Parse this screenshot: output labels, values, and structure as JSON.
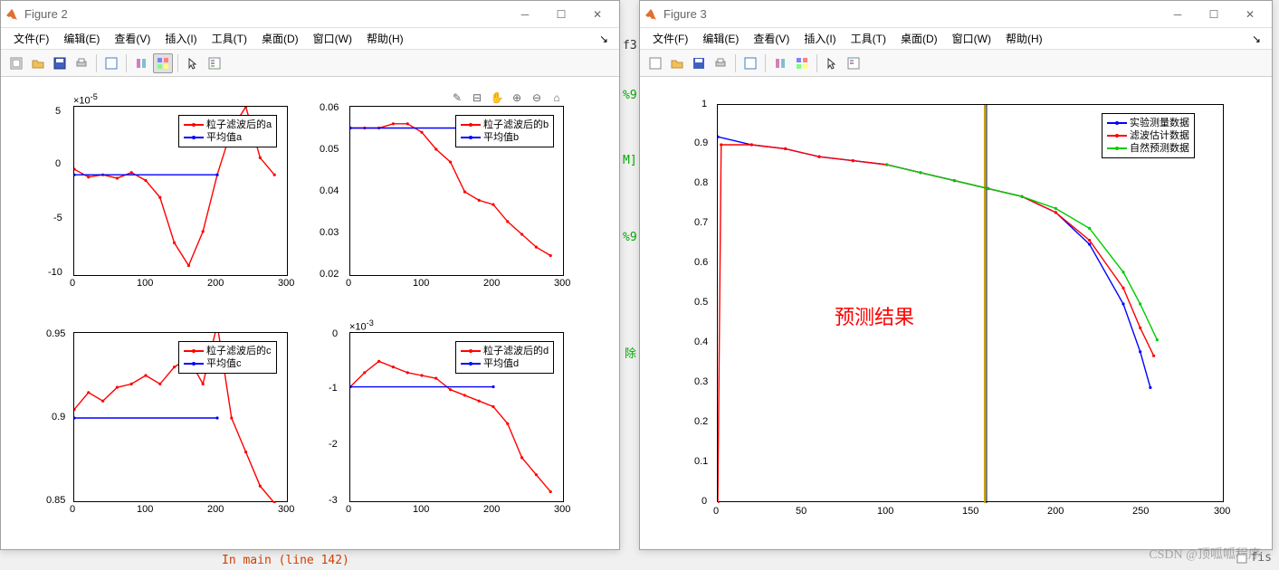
{
  "windows": [
    {
      "title": "Figure 2"
    },
    {
      "title": "Figure 3"
    }
  ],
  "menus": [
    "文件(F)",
    "编辑(E)",
    "查看(V)",
    "插入(I)",
    "工具(T)",
    "桌面(D)",
    "窗口(W)",
    "帮助(H)"
  ],
  "figure2": {
    "sub_a": {
      "exponent": "×10",
      "exponent_sup": "-5",
      "yticks": [
        "5",
        "0",
        "-5",
        "-10"
      ],
      "xticks": [
        "0",
        "100",
        "200",
        "300"
      ],
      "legend": [
        "粒子滤波后的a",
        "平均值a"
      ]
    },
    "sub_b": {
      "yticks": [
        "0.06",
        "0.05",
        "0.04",
        "0.03",
        "0.02"
      ],
      "xticks": [
        "0",
        "100",
        "200",
        "300"
      ],
      "legend": [
        "粒子滤波后的b",
        "平均值b"
      ]
    },
    "sub_c": {
      "yticks": [
        "0.95",
        "0.9",
        "0.85"
      ],
      "xticks": [
        "0",
        "100",
        "200",
        "300"
      ],
      "legend": [
        "粒子滤波后的c",
        "平均值c"
      ]
    },
    "sub_d": {
      "exponent": "×10",
      "exponent_sup": "-3",
      "yticks": [
        "0",
        "-1",
        "-2",
        "-3"
      ],
      "xticks": [
        "0",
        "100",
        "200",
        "300"
      ],
      "legend": [
        "粒子滤波后的d",
        "平均值d"
      ]
    }
  },
  "figure3": {
    "yticks": [
      "1",
      "0.9",
      "0.8",
      "0.7",
      "0.6",
      "0.5",
      "0.4",
      "0.3",
      "0.2",
      "0.1",
      "0"
    ],
    "xticks": [
      "0",
      "50",
      "100",
      "150",
      "200",
      "250",
      "300"
    ],
    "legend": [
      "实验测量数据",
      "滤波估计数据",
      "自然预测数据"
    ],
    "annotation": "预测结果"
  },
  "bg": {
    "f3": "f3",
    "m": "M]",
    "pct1": "%9",
    "pct2": "%9",
    "chu": "除",
    "main_line": "In main (line 142)",
    "fis": "fis"
  },
  "watermark": "CSDN @顶呱呱程序",
  "chart_data": [
    {
      "type": "line",
      "title": "",
      "xlabel": "",
      "ylabel": "",
      "exponent": 1e-05,
      "xlim": [
        0,
        300
      ],
      "ylim": [
        -10,
        5
      ],
      "series": [
        {
          "name": "粒子滤波后的a",
          "color": "#ff0000",
          "x": [
            0,
            20,
            40,
            60,
            80,
            100,
            120,
            140,
            160,
            180,
            200,
            220,
            240,
            260,
            280
          ],
          "y": [
            -0.5,
            -1.2,
            -1.0,
            -1.3,
            -0.8,
            -1.5,
            -3.0,
            -7.0,
            -9.0,
            -6.0,
            -1.0,
            3.0,
            5.0,
            0.5,
            -1.0
          ]
        },
        {
          "name": "平均值a",
          "color": "#0000ff",
          "x": [
            0,
            200
          ],
          "y": [
            -1.0,
            -1.0
          ]
        }
      ]
    },
    {
      "type": "line",
      "title": "",
      "xlabel": "",
      "ylabel": "",
      "xlim": [
        0,
        300
      ],
      "ylim": [
        0.02,
        0.06
      ],
      "series": [
        {
          "name": "粒子滤波后的b",
          "color": "#ff0000",
          "x": [
            0,
            20,
            40,
            60,
            80,
            100,
            120,
            140,
            160,
            180,
            200,
            220,
            240,
            260,
            280
          ],
          "y": [
            0.055,
            0.055,
            0.055,
            0.056,
            0.056,
            0.054,
            0.05,
            0.047,
            0.04,
            0.038,
            0.037,
            0.033,
            0.03,
            0.027,
            0.025
          ]
        },
        {
          "name": "平均值b",
          "color": "#0000ff",
          "x": [
            0,
            200
          ],
          "y": [
            0.055,
            0.055
          ]
        }
      ]
    },
    {
      "type": "line",
      "title": "",
      "xlabel": "",
      "ylabel": "",
      "xlim": [
        0,
        300
      ],
      "ylim": [
        0.85,
        0.95
      ],
      "series": [
        {
          "name": "粒子滤波后的c",
          "color": "#ff0000",
          "x": [
            0,
            20,
            40,
            60,
            80,
            100,
            120,
            140,
            160,
            180,
            200,
            220,
            240,
            260,
            280
          ],
          "y": [
            0.905,
            0.915,
            0.91,
            0.918,
            0.92,
            0.925,
            0.92,
            0.93,
            0.935,
            0.92,
            0.955,
            0.9,
            0.88,
            0.86,
            0.85
          ]
        },
        {
          "name": "平均值c",
          "color": "#0000ff",
          "x": [
            0,
            200
          ],
          "y": [
            0.9,
            0.9
          ]
        }
      ]
    },
    {
      "type": "line",
      "title": "",
      "xlabel": "",
      "ylabel": "",
      "exponent": 0.001,
      "xlim": [
        0,
        300
      ],
      "ylim": [
        -3,
        0
      ],
      "series": [
        {
          "name": "粒子滤波后的d",
          "color": "#ff0000",
          "x": [
            0,
            20,
            40,
            60,
            80,
            100,
            120,
            140,
            160,
            180,
            200,
            220,
            240,
            260,
            280
          ],
          "y": [
            -0.95,
            -0.7,
            -0.5,
            -0.6,
            -0.7,
            -0.75,
            -0.8,
            -1.0,
            -1.1,
            -1.2,
            -1.3,
            -1.6,
            -2.2,
            -2.5,
            -2.8
          ]
        },
        {
          "name": "平均值d",
          "color": "#0000ff",
          "x": [
            0,
            200
          ],
          "y": [
            -0.95,
            -0.95
          ]
        }
      ]
    },
    {
      "type": "line",
      "title": "",
      "xlabel": "",
      "ylabel": "",
      "xlim": [
        0,
        300
      ],
      "ylim": [
        0,
        1
      ],
      "annotation": "预测结果",
      "vline": 158,
      "series": [
        {
          "name": "实验测量数据",
          "color": "#0000ff",
          "x": [
            0,
            20,
            40,
            60,
            80,
            100,
            120,
            140,
            160,
            180,
            200,
            220,
            240,
            250,
            256
          ],
          "y": [
            0.92,
            0.9,
            0.89,
            0.87,
            0.86,
            0.85,
            0.83,
            0.81,
            0.79,
            0.77,
            0.73,
            0.65,
            0.5,
            0.38,
            0.29
          ]
        },
        {
          "name": "滤波估计数据",
          "color": "#ff0000",
          "x": [
            0,
            2,
            20,
            40,
            60,
            80,
            100,
            120,
            140,
            160,
            180,
            200,
            220,
            240,
            250,
            258
          ],
          "y": [
            0.0,
            0.9,
            0.9,
            0.89,
            0.87,
            0.86,
            0.85,
            0.83,
            0.81,
            0.79,
            0.77,
            0.73,
            0.66,
            0.54,
            0.44,
            0.37
          ]
        },
        {
          "name": "自然预测数据",
          "color": "#00cc00",
          "x": [
            100,
            120,
            140,
            160,
            180,
            200,
            220,
            240,
            250,
            260
          ],
          "y": [
            0.85,
            0.83,
            0.81,
            0.79,
            0.77,
            0.74,
            0.69,
            0.58,
            0.5,
            0.41
          ]
        }
      ]
    }
  ]
}
